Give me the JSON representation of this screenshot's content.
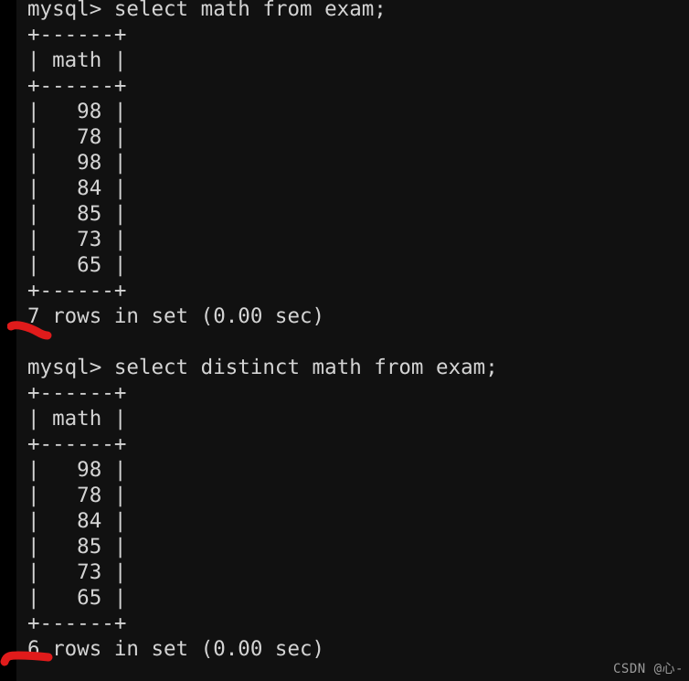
{
  "terminal": {
    "background_color": "#0d0d0d",
    "body_color": "#111111",
    "text_color": "#d4d4d4",
    "annotation_color": "#e01b1b",
    "prompt": "mysql>"
  },
  "blocks": [
    {
      "command": "mysql> select math from exam;",
      "table": {
        "border": "+------+",
        "header": "| math |",
        "columns": [
          "math"
        ],
        "rows": [
          "|   98 |",
          "|   78 |",
          "|   98 |",
          "|   84 |",
          "|   85 |",
          "|   73 |",
          "|   65 |"
        ],
        "values": [
          98,
          78,
          98,
          84,
          85,
          73,
          65
        ]
      },
      "status": "7 rows in set (0.00 sec)",
      "row_count": 7,
      "elapsed": "0.00 sec"
    },
    {
      "command": "mysql> select distinct math from exam;",
      "table": {
        "border": "+------+",
        "header": "| math |",
        "columns": [
          "math"
        ],
        "rows": [
          "|   98 |",
          "|   78 |",
          "|   84 |",
          "|   85 |",
          "|   73 |",
          "|   65 |"
        ],
        "values": [
          98,
          78,
          84,
          85,
          73,
          65
        ]
      },
      "status": "6 rows in set (0.00 sec)",
      "row_count": 6,
      "elapsed": "0.00 sec"
    }
  ],
  "lines": [
    "mysql> select math from exam;",
    "+------+",
    "| math |",
    "+------+",
    "|   98 |",
    "|   78 |",
    "|   98 |",
    "|   84 |",
    "|   85 |",
    "|   73 |",
    "|   65 |",
    "+------+",
    "7 rows in set (0.00 sec)",
    "",
    "mysql> select distinct math from exam;",
    "+------+",
    "| math |",
    "+------+",
    "|   98 |",
    "|   78 |",
    "|   84 |",
    "|   85 |",
    "|   73 |",
    "|   65 |",
    "+------+",
    "6 rows in set (0.00 sec)"
  ],
  "watermark": {
    "text": "CSDN @心-"
  }
}
